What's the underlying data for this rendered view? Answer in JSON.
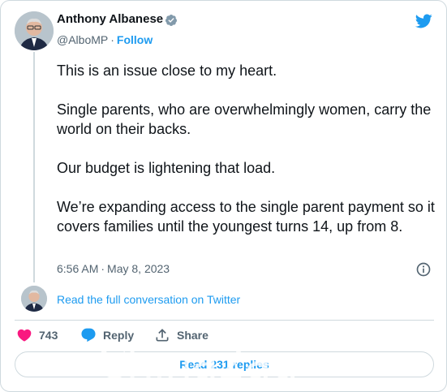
{
  "author": {
    "name": "Anthony Albanese",
    "handle": "@AlboMP",
    "separator": "·",
    "follow_label": "Follow"
  },
  "tweet": {
    "paragraphs": [
      "This is an issue close to my heart.",
      "Single parents, who are overwhelmingly women, carry the world on their backs.",
      "Our budget is lightening that load.",
      "We’re expanding access to the single parent payment so it covers families until the youngest turns 14, up from 8."
    ],
    "time": "6:56 AM",
    "separator": "·",
    "date": "May 8, 2023"
  },
  "conversation_link": "Read the full conversation on Twitter",
  "actions": {
    "like_count": "743",
    "reply_label": "Reply",
    "share_label": "Share"
  },
  "replies_button": "Read 231 replies",
  "watermark": "Chinа2au",
  "icons": {
    "verified": "verified-badge-icon",
    "logo": "twitter-bird-icon",
    "info": "info-icon",
    "like": "heart-icon",
    "reply": "speech-bubble-icon",
    "share": "share-arrow-icon"
  },
  "colors": {
    "accent": "#1d9bf0",
    "like": "#f91880",
    "text": "#0f1419",
    "secondary": "#536471",
    "border": "#cfd9de"
  }
}
